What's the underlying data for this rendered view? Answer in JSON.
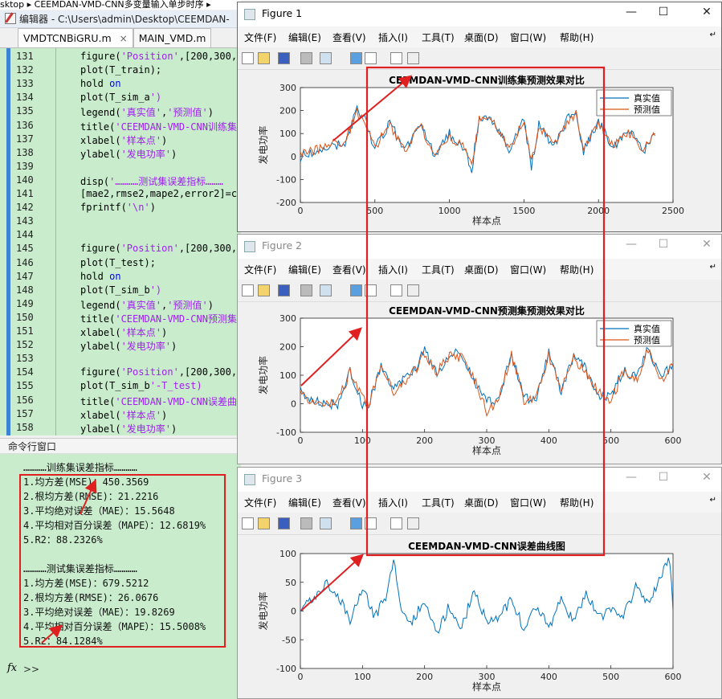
{
  "breadcrumb": {
    "text": "sktop ▸ CEEMDAN-VMD-CNN多变量输入单步时序 ▸"
  },
  "editor": {
    "title": "编辑器 - C:\\Users\\admin\\Desktop\\CEEMDAN-",
    "tabs": [
      {
        "label": "VMDTCNBiGRU.m",
        "close": "×"
      },
      {
        "label": "MAIN_VMD.m"
      }
    ],
    "lines": [
      {
        "n": "131",
        "code": "figure('Position',[200,300,"
      },
      {
        "n": "132",
        "code": "plot(T_train);"
      },
      {
        "n": "133",
        "code": "hold on"
      },
      {
        "n": "134",
        "code": "plot(T_sim_a')"
      },
      {
        "n": "135",
        "code": "legend('真实值','预测值')"
      },
      {
        "n": "136",
        "code": "title('CEEMDAN-VMD-CNN训练集"
      },
      {
        "n": "137",
        "code": "xlabel('样本点')"
      },
      {
        "n": "138",
        "code": "ylabel('发电功率')"
      },
      {
        "n": "139",
        "code": ""
      },
      {
        "n": "140",
        "code": "disp('…………测试集误差指标………"
      },
      {
        "n": "141",
        "code": "[mae2,rmse2,mape2,error2]=c"
      },
      {
        "n": "142",
        "code": "fprintf('\\n')"
      },
      {
        "n": "143",
        "code": ""
      },
      {
        "n": "144",
        "code": ""
      },
      {
        "n": "145",
        "code": "figure('Position',[200,300,"
      },
      {
        "n": "146",
        "code": "plot(T_test);"
      },
      {
        "n": "147",
        "code": "hold on"
      },
      {
        "n": "148",
        "code": "plot(T_sim_b')"
      },
      {
        "n": "149",
        "code": "legend('真实值','预测值')"
      },
      {
        "n": "150",
        "code": "title('CEEMDAN-VMD-CNN预测集"
      },
      {
        "n": "151",
        "code": "xlabel('样本点')"
      },
      {
        "n": "152",
        "code": "ylabel('发电功率')"
      },
      {
        "n": "153",
        "code": ""
      },
      {
        "n": "154",
        "code": "figure('Position',[200,300,"
      },
      {
        "n": "155",
        "code": "plot(T_sim_b'-T_test)"
      },
      {
        "n": "156",
        "code": "title('CEEMDAN-VMD-CNN误差曲"
      },
      {
        "n": "157",
        "code": "xlabel('样本点')"
      },
      {
        "n": "158",
        "code": "ylabel('发电功率')"
      }
    ]
  },
  "command_window": {
    "header": "命令行窗口",
    "lines": [
      "…………训练集误差指标…………",
      "1.均方差(MSE)：450.3569",
      "2.根均方差(RMSE)：21.2216",
      "3.平均绝对误差（MAE）：15.5648",
      "4.平均相对百分误差（MAPE）：12.6819%",
      "5.R2：88.2326%",
      "",
      "…………测试集误差指标…………",
      "1.均方差(MSE)：679.5212",
      "2.根均方差(RMSE)：26.0676",
      "3.平均绝对误差（MAE）：19.8269",
      "4.平均相对百分误差（MAPE）：15.5008%",
      "5.R2：84.1284%"
    ],
    "prompt": ">>",
    "fx": "fx"
  },
  "figure_menu": [
    "文件(F)",
    "编辑(E)",
    "查看(V)",
    "插入(I)",
    "工具(T)",
    "桌面(D)",
    "窗口(W)",
    "帮助(H)"
  ],
  "figures": [
    {
      "title": "Figure 1",
      "active": true
    },
    {
      "title": "Figure 2",
      "active": false
    },
    {
      "title": "Figure 3",
      "active": false
    }
  ],
  "colors": {
    "true_line": "#0072bd",
    "pred_line": "#d95319",
    "highlight": "#e02020"
  },
  "chart_data": [
    {
      "type": "line",
      "title": "CEEMDAN-VMD-CNN训练集预测效果对比",
      "xlabel": "样本点",
      "ylabel": "发电功率",
      "xlim": [
        0,
        2500
      ],
      "ylim": [
        -200,
        300
      ],
      "xticks": [
        0,
        500,
        1000,
        1500,
        2000,
        2500
      ],
      "yticks": [
        -200,
        -100,
        0,
        100,
        200,
        300
      ],
      "legend": [
        "真实值",
        "预测值"
      ],
      "legend_loc": "top-right",
      "series": [
        {
          "name": "真实值",
          "x": [
            0,
            100,
            200,
            300,
            380,
            420,
            500,
            600,
            700,
            800,
            900,
            1000,
            1100,
            1150,
            1200,
            1300,
            1400,
            1500,
            1550,
            1600,
            1700,
            1800,
            1850,
            1900,
            2000,
            2100,
            2200,
            2300,
            2380
          ],
          "values": [
            0,
            20,
            40,
            60,
            200,
            180,
            30,
            150,
            20,
            150,
            10,
            100,
            30,
            -60,
            180,
            150,
            20,
            160,
            -40,
            140,
            40,
            170,
            200,
            20,
            150,
            40,
            120,
            20,
            100
          ]
        },
        {
          "name": "预测值",
          "x": [
            0,
            100,
            200,
            300,
            380,
            420,
            500,
            600,
            700,
            800,
            900,
            1000,
            1100,
            1150,
            1200,
            1300,
            1400,
            1500,
            1550,
            1600,
            1700,
            1800,
            1850,
            1900,
            2000,
            2100,
            2200,
            2300,
            2380
          ],
          "values": [
            10,
            30,
            50,
            70,
            190,
            170,
            40,
            140,
            30,
            140,
            20,
            90,
            40,
            -50,
            170,
            140,
            30,
            150,
            -30,
            130,
            50,
            160,
            190,
            30,
            140,
            50,
            110,
            30,
            90
          ]
        }
      ]
    },
    {
      "type": "line",
      "title": "CEEMDAN-VMD-CNN预测集预测效果对比",
      "xlabel": "样本点",
      "ylabel": "发电功率",
      "xlim": [
        0,
        600
      ],
      "ylim": [
        -100,
        300
      ],
      "xticks": [
        0,
        100,
        200,
        300,
        400,
        500,
        600
      ],
      "yticks": [
        -100,
        0,
        100,
        200,
        300
      ],
      "legend": [
        "真实值",
        "预测值"
      ],
      "legend_loc": "top-right",
      "series": [
        {
          "name": "真实值",
          "x": [
            0,
            20,
            40,
            60,
            80,
            100,
            110,
            130,
            150,
            170,
            190,
            200,
            220,
            240,
            260,
            280,
            300,
            320,
            340,
            360,
            380,
            400,
            420,
            440,
            460,
            480,
            500,
            520,
            540,
            560,
            580,
            600
          ],
          "values": [
            40,
            10,
            0,
            0,
            120,
            0,
            0,
            130,
            50,
            90,
            140,
            190,
            100,
            180,
            170,
            80,
            10,
            10,
            180,
            20,
            20,
            180,
            40,
            170,
            120,
            30,
            20,
            120,
            90,
            200,
            90,
            140
          ]
        },
        {
          "name": "预测值",
          "x": [
            0,
            20,
            40,
            60,
            80,
            100,
            110,
            130,
            150,
            170,
            190,
            200,
            220,
            240,
            260,
            280,
            300,
            320,
            340,
            360,
            380,
            400,
            420,
            440,
            460,
            480,
            500,
            520,
            540,
            560,
            580,
            600
          ],
          "values": [
            50,
            0,
            -10,
            10,
            110,
            20,
            -10,
            140,
            40,
            80,
            130,
            180,
            110,
            170,
            160,
            90,
            -30,
            20,
            170,
            10,
            30,
            170,
            50,
            160,
            110,
            40,
            10,
            110,
            80,
            190,
            80,
            130
          ]
        }
      ]
    },
    {
      "type": "line",
      "title": "CEEMDAN-VMD-CNN误差曲线图",
      "xlabel": "样本点",
      "ylabel": "发电功率",
      "xlim": [
        0,
        600
      ],
      "ylim": [
        -100,
        100
      ],
      "xticks": [
        0,
        100,
        200,
        300,
        400,
        500,
        600
      ],
      "yticks": [
        -100,
        -50,
        0,
        50,
        100
      ],
      "series": [
        {
          "x": [
            0,
            20,
            40,
            60,
            80,
            100,
            120,
            140,
            150,
            160,
            180,
            200,
            220,
            240,
            260,
            280,
            300,
            320,
            340,
            360,
            380,
            400,
            420,
            440,
            460,
            480,
            500,
            520,
            540,
            560,
            580,
            595,
            600
          ],
          "values": [
            0,
            20,
            50,
            30,
            -20,
            40,
            -10,
            30,
            95,
            10,
            -20,
            20,
            -40,
            10,
            -30,
            40,
            -20,
            -10,
            20,
            -30,
            10,
            -30,
            20,
            -20,
            30,
            -10,
            0,
            -10,
            40,
            10,
            60,
            90,
            0
          ]
        }
      ]
    }
  ]
}
